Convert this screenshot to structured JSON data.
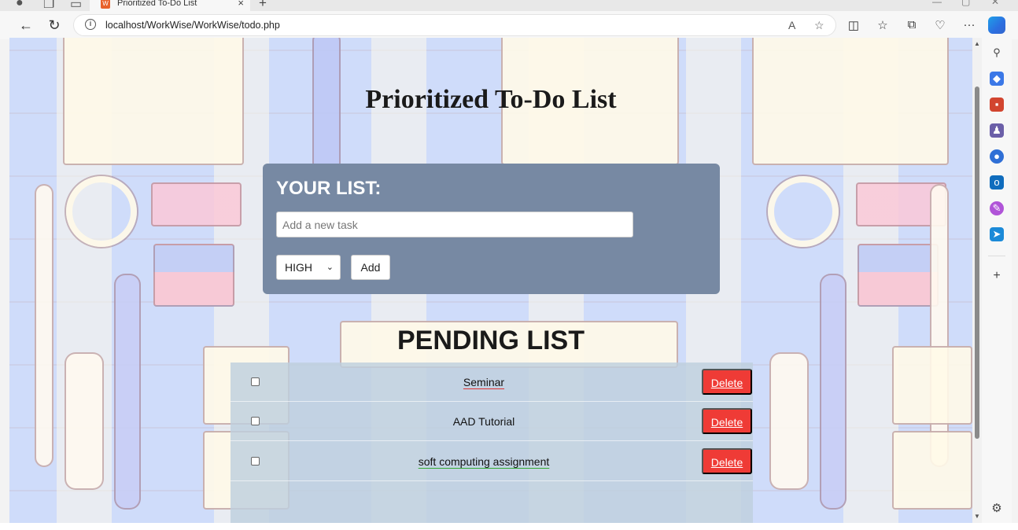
{
  "browser": {
    "tab_title": "Prioritized To-Do List",
    "tab_close": "×",
    "new_tab": "+",
    "url": "localhost/WorkWise/WorkWise/todo.php",
    "nav_back": "←",
    "nav_reload": "↻",
    "more": "···"
  },
  "page": {
    "title": "Prioritized To-Do List",
    "list_heading": "YOUR LIST:",
    "task_placeholder": "Add a new task",
    "priority_selected": "HIGH",
    "add_label": "Add",
    "pending_heading": "PENDING LIST"
  },
  "tasks": [
    {
      "text": "Seminar",
      "delete_label": "Delete"
    },
    {
      "text": "AAD Tutorial",
      "delete_label": "Delete"
    },
    {
      "text": "soft computing assignment",
      "delete_label": "Delete"
    }
  ],
  "colors": {
    "card": "#7789a3",
    "delete": "#ef3b36",
    "background": "#cfdcfa"
  }
}
